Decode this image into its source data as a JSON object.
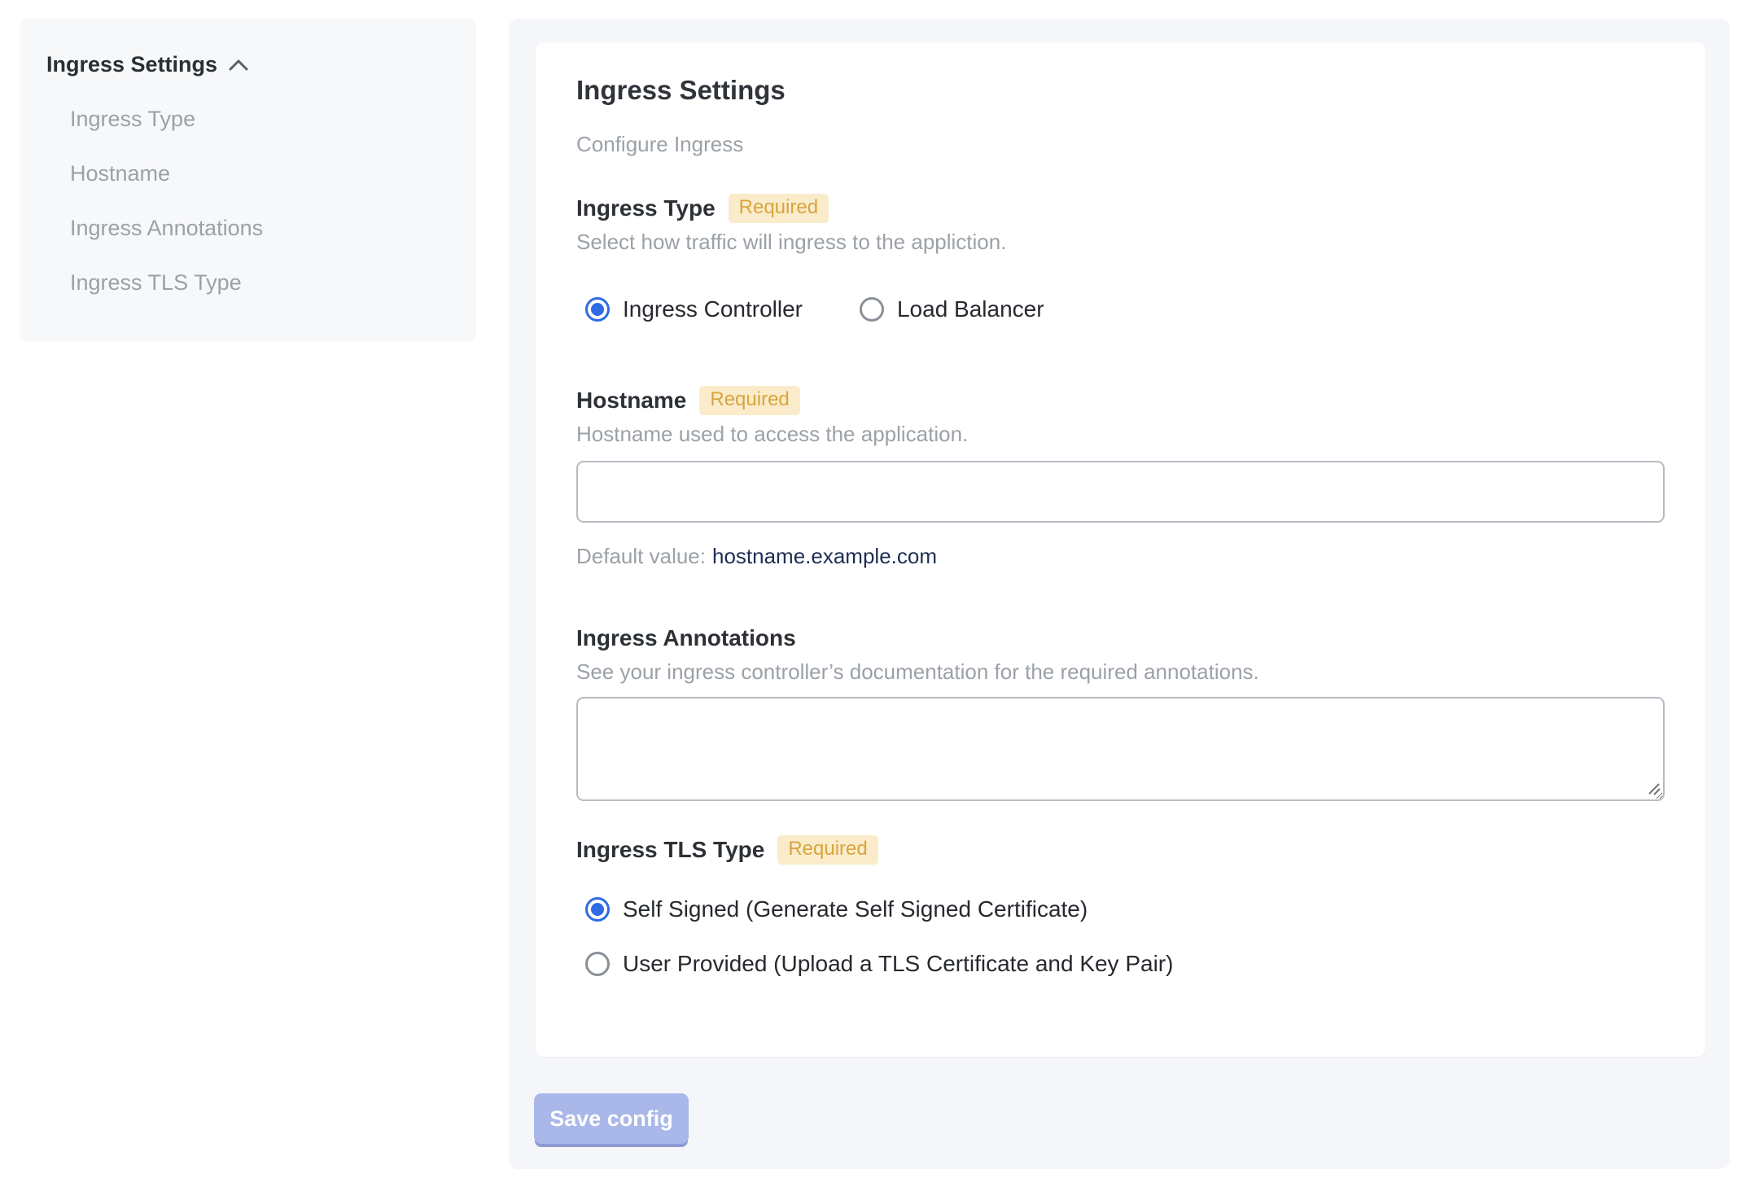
{
  "sidebar": {
    "heading": "Ingress Settings",
    "items": [
      {
        "label": "Ingress Type"
      },
      {
        "label": "Hostname"
      },
      {
        "label": "Ingress Annotations"
      },
      {
        "label": "Ingress TLS Type"
      }
    ]
  },
  "main": {
    "title": "Ingress Settings",
    "subtitle": "Configure Ingress",
    "required_badge": "Required",
    "sections": {
      "ingress_type": {
        "heading": "Ingress Type",
        "required": true,
        "help": "Select how traffic will ingress to the appliction.",
        "options": [
          {
            "label": "Ingress Controller",
            "selected": true
          },
          {
            "label": "Load Balancer",
            "selected": false
          }
        ]
      },
      "hostname": {
        "heading": "Hostname",
        "required": true,
        "help": "Hostname used to access the application.",
        "value": "",
        "default_label": "Default value:",
        "default_value": "hostname.example.com"
      },
      "annotations": {
        "heading": "Ingress Annotations",
        "required": false,
        "help": "See your ingress controller’s documentation for the required annotations.",
        "value": ""
      },
      "tls": {
        "heading": "Ingress TLS Type",
        "required": true,
        "options": [
          {
            "label": "Self Signed (Generate Self Signed Certificate)",
            "selected": true
          },
          {
            "label": "User Provided (Upload a TLS Certificate and Key Pair)",
            "selected": false
          }
        ]
      }
    },
    "save_button": "Save config"
  },
  "icons": {
    "sidebar_collapse": "chevron-up-icon",
    "textarea_resize": "resize-handle-icon"
  },
  "colors": {
    "accent_blue": "#2f6be4",
    "badge_bg": "#faecca",
    "badge_text": "#d9a43e",
    "sidebar_bg": "#f7f8fa",
    "panel_bg": "#f5f6f9",
    "help_text": "#9ba1a8",
    "default_value_text": "#1f2e52",
    "save_button_bg": "#a9b7e9"
  }
}
